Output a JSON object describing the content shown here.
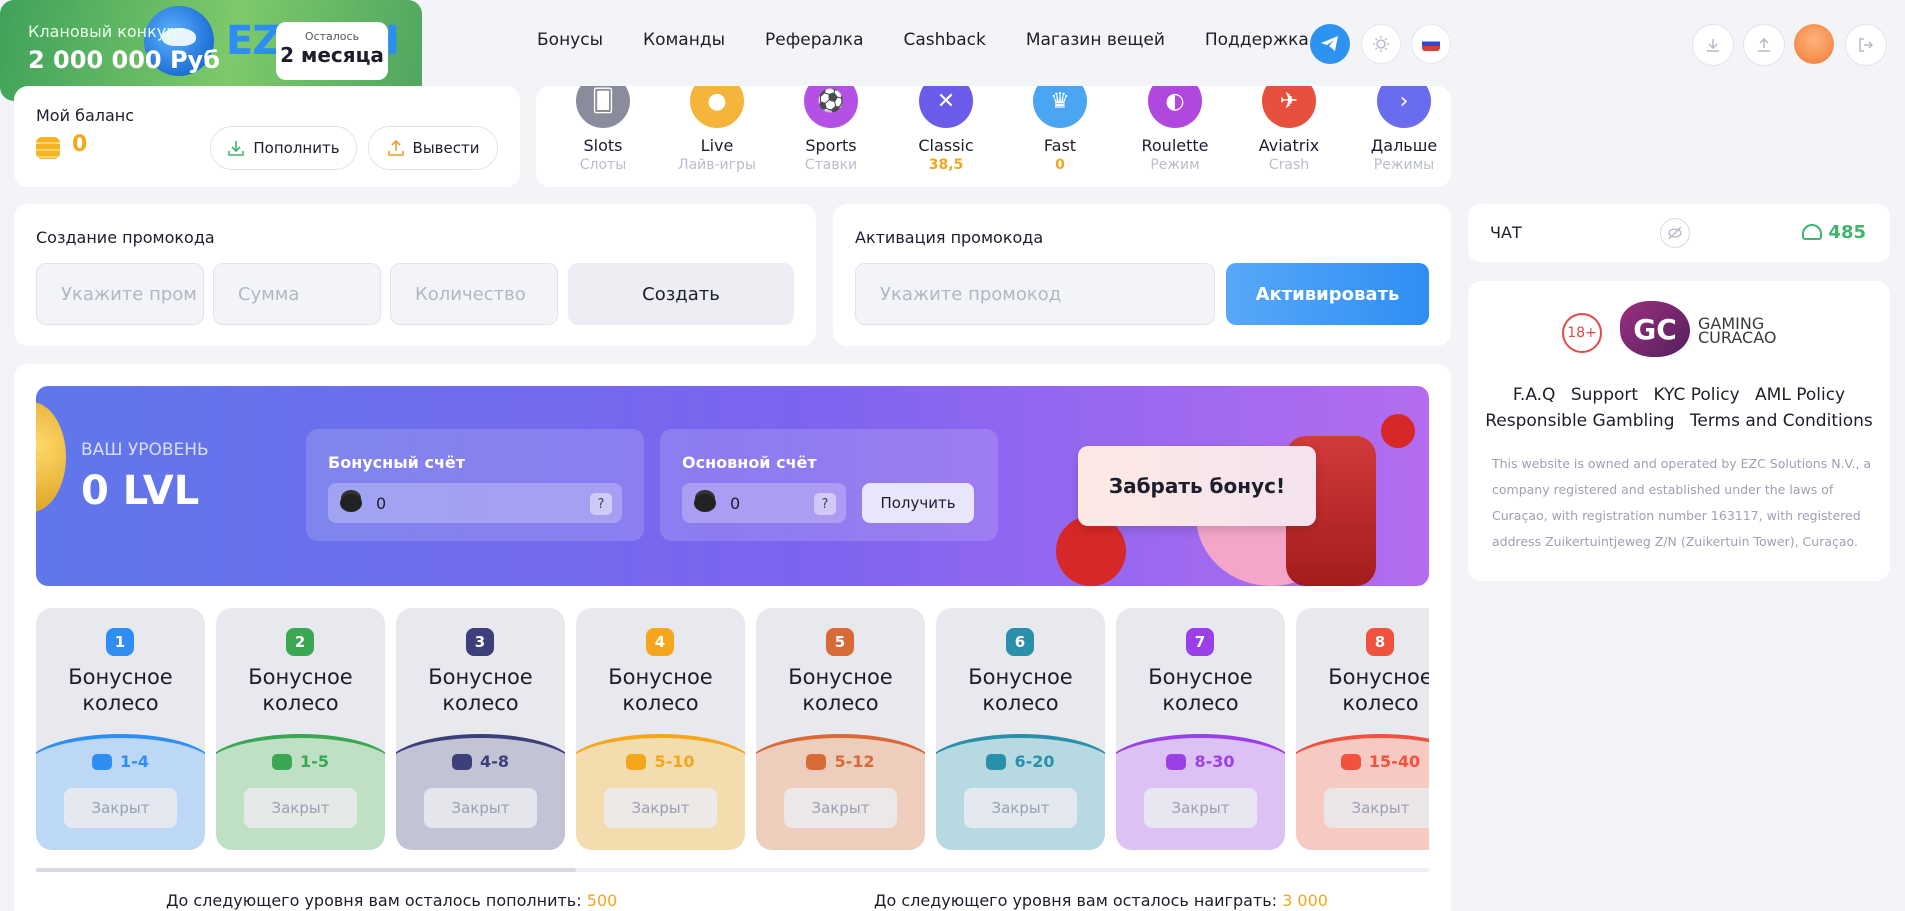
{
  "brand": {
    "name": "EZCASH"
  },
  "nav": [
    "Бонусы",
    "Команды",
    "Рефералка",
    "Cashback",
    "Магазин вещей",
    "Поддержка"
  ],
  "balance": {
    "title": "Мой баланс",
    "value": "0",
    "deposit_label": "Пополнить",
    "withdraw_label": "Вывести"
  },
  "games": [
    {
      "name": "Slots",
      "sub": "Слоты",
      "icon": "cards-icon",
      "color": "#8a8c9c"
    },
    {
      "name": "Live",
      "sub": "Лайв-игры",
      "icon": "person-icon",
      "color": "#f4b53a"
    },
    {
      "name": "Sports",
      "sub": "Ставки",
      "icon": "ball-icon",
      "color": "#b450e6"
    },
    {
      "name": "Classic",
      "sub": "38,5",
      "icon": "swords-icon",
      "color": "#6a5ce8"
    },
    {
      "name": "Fast",
      "sub": "0",
      "icon": "crown-icon",
      "color": "#4aa5f3"
    },
    {
      "name": "Roulette",
      "sub": "Режим",
      "icon": "roulette-icon",
      "color": "#b048e0"
    },
    {
      "name": "Aviatrix",
      "sub": "Crash",
      "icon": "plane-icon",
      "color": "#e6503c"
    },
    {
      "name": "Дальше",
      "sub": "Режимы",
      "icon": "chevron-right-icon",
      "color": "#6a6cf0"
    }
  ],
  "contest": {
    "title": "Клановый конкурс",
    "prize": "2 000 000 Руб",
    "remain_label": "Осталось",
    "remain_value": "2 месяца"
  },
  "promo_create": {
    "title": "Создание промокода",
    "ph_code": "Укажите пром",
    "ph_sum": "Сумма",
    "ph_qty": "Количество",
    "create_label": "Создать"
  },
  "promo_activate": {
    "title": "Активация промокода",
    "ph_code": "Укажите промокод",
    "activate_label": "Активировать"
  },
  "chat": {
    "title": "ЧАТ",
    "online": "485"
  },
  "info": {
    "age": "18+",
    "gc_line1": "GAMING",
    "gc_line2": "CURACAO",
    "links_row1": [
      "F.A.Q",
      "Support",
      "KYC Policy",
      "AML Policy"
    ],
    "links_row2": [
      "Responsible Gambling",
      "Terms and Conditions"
    ],
    "legal": "This website is owned and operated by EZC Solutions N.V., a company registered and established under the laws of Curaçao, with registration number 163117, with registered address Zuikertuintjeweg Z/N (Zuikertuin Tower), Curaçao."
  },
  "level": {
    "label": "ВАШ УРОВЕНЬ",
    "value": "0 LVL",
    "bonus_title": "Бонусный счёт",
    "bonus_value": "0",
    "main_title": "Основной счёт",
    "main_value": "0",
    "get_label": "Получить",
    "claim_label": "Забрать бонус!"
  },
  "wheels": [
    {
      "num": "1",
      "name1": "Бонусное",
      "name2": "колесо",
      "range": "1-4",
      "color": "#2e8ef3",
      "bg": "#bcd8f4",
      "status": "Закрыт"
    },
    {
      "num": "2",
      "name1": "Бонусное",
      "name2": "колесо",
      "range": "1-5",
      "color": "#3aa853",
      "bg": "#bfe0c4",
      "status": "Закрыт"
    },
    {
      "num": "3",
      "name1": "Бонусное",
      "name2": "колесо",
      "range": "4-8",
      "color": "#3d3f7a",
      "bg": "#c2c4d6",
      "status": "Закрыт"
    },
    {
      "num": "4",
      "name1": "Бонусное",
      "name2": "колесо",
      "range": "5-10",
      "color": "#f5a61a",
      "bg": "#f3dcae",
      "status": "Закрыт"
    },
    {
      "num": "5",
      "name1": "Бонусное",
      "name2": "колесо",
      "range": "5-12",
      "color": "#d76a36",
      "bg": "#efcdbc",
      "status": "Закрыт"
    },
    {
      "num": "6",
      "name1": "Бонусное",
      "name2": "колесо",
      "range": "6-20",
      "color": "#2a8fab",
      "bg": "#b7d9e2",
      "status": "Закрыт"
    },
    {
      "num": "7",
      "name1": "Бонусное",
      "name2": "колесо",
      "range": "8-30",
      "color": "#9b3fe6",
      "bg": "#dcc2f4",
      "status": "Закрыт"
    },
    {
      "num": "8",
      "name1": "Бонусное",
      "name2": "колесо",
      "range": "15-40",
      "color": "#f0523e",
      "bg": "#f6c9c2",
      "status": "Закрыт"
    }
  ],
  "remain": {
    "deposit_text": "До следующего уровня вам осталось пополнить:",
    "deposit_value": "500",
    "play_text": "До следующего уровня вам осталось наиграть:",
    "play_value": "3 000"
  }
}
